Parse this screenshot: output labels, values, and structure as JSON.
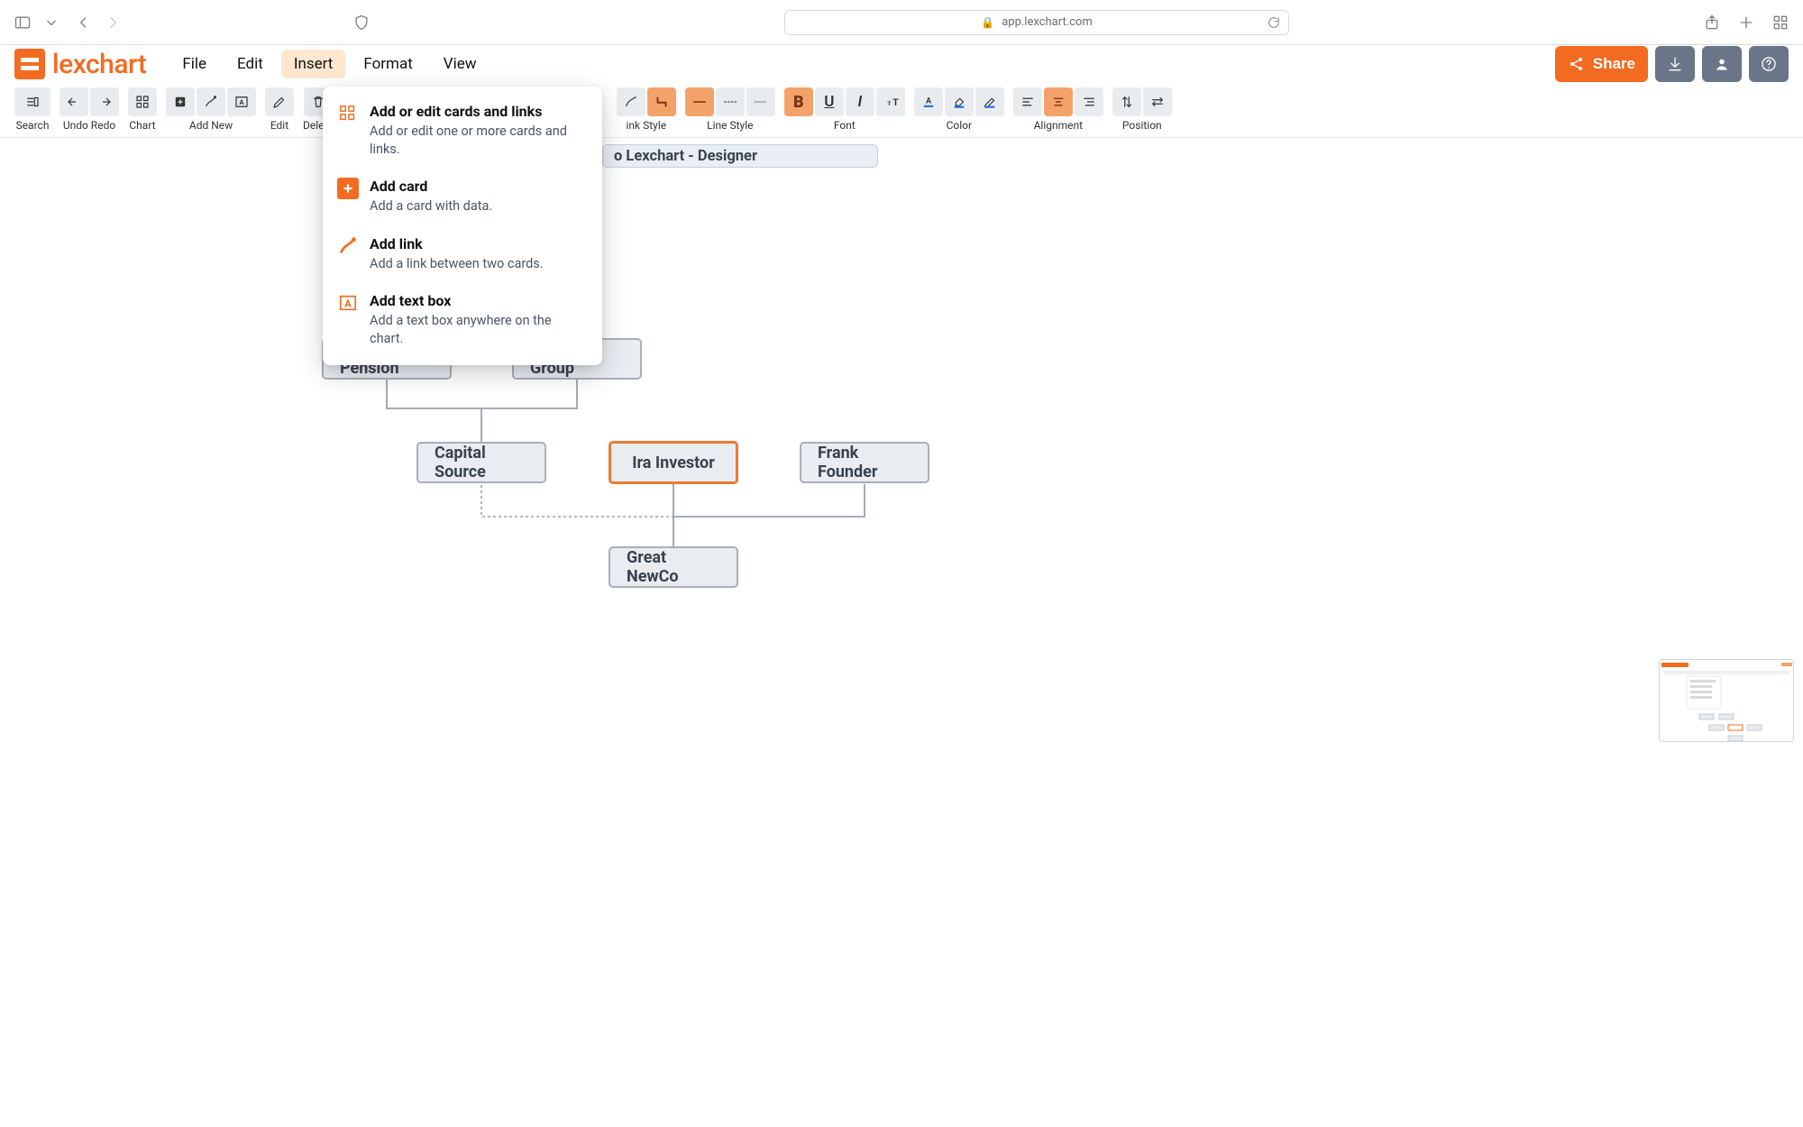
{
  "browser": {
    "url": "app.lexchart.com"
  },
  "logo": {
    "text": "lexchart"
  },
  "menu": {
    "file": "File",
    "edit": "Edit",
    "insert": "Insert",
    "format": "Format",
    "view": "View"
  },
  "header_buttons": {
    "share": "Share"
  },
  "toolbar": {
    "search": "Search",
    "undo_redo": "Undo Redo",
    "chart": "Chart",
    "add_new": "Add New",
    "edit": "Edit",
    "delete": "Delete",
    "link_style": "ink Style",
    "line_style": "Line Style",
    "font": "Font",
    "color": "Color",
    "alignment": "Alignment",
    "position": "Position"
  },
  "insert_menu": {
    "items": [
      {
        "title": "Add or edit cards and links",
        "sub": "Add or edit one or more cards and links."
      },
      {
        "title": "Add card",
        "sub": "Add a card with data."
      },
      {
        "title": "Add link",
        "sub": "Add a link between two cards."
      },
      {
        "title": "Add text box",
        "sub": "Add a text box anywhere on the chart."
      }
    ]
  },
  "document_title": "o Lexchart - Designer",
  "cards": {
    "global_pension": "Global Pension",
    "ocean_group": "Ocean Group",
    "capital_source": "Capital Source",
    "ira_investor": "Ira Investor",
    "frank_founder": "Frank Founder",
    "great_newco": "Great NewCo"
  }
}
